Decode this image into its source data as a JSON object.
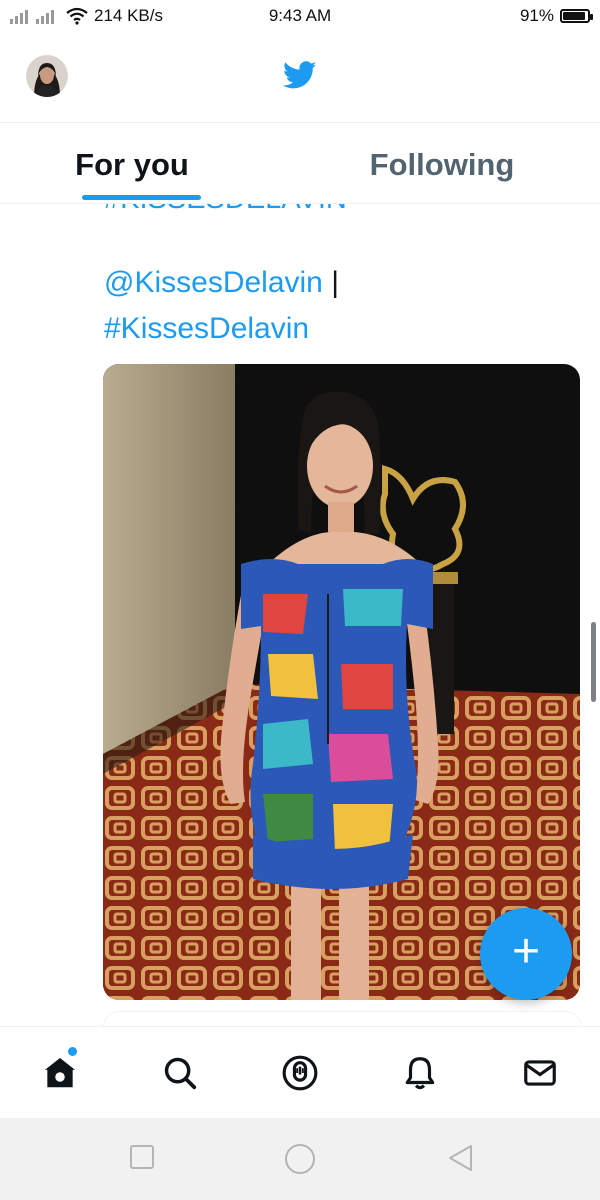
{
  "status_bar": {
    "network_speed": "214 KB/s",
    "time": "9:43 AM",
    "battery_text": "91%",
    "battery_level": 0.91
  },
  "header": {
    "logo_icon": "twitter-bird-icon",
    "avatar_icon": "profile-avatar"
  },
  "tabs": [
    {
      "label": "For you",
      "active": true
    },
    {
      "label": "Following",
      "active": false
    }
  ],
  "tweet": {
    "cut_off_hashtag": "#KISSESDELAVIN",
    "mention": "@KissesDelavin",
    "separator": "|",
    "hashtag": "#KissesDelavin"
  },
  "fab": {
    "label": "+",
    "icon": "compose-plus-icon"
  },
  "bottom_nav": [
    "home-icon",
    "search-icon",
    "spaces-icon",
    "notifications-icon",
    "messages-icon"
  ],
  "android_nav": [
    "recent-apps-icon",
    "home-circle-icon",
    "back-icon"
  ],
  "colors": {
    "accent": "#1d9bf0",
    "text": "#0f1419",
    "secondary": "#536471"
  }
}
